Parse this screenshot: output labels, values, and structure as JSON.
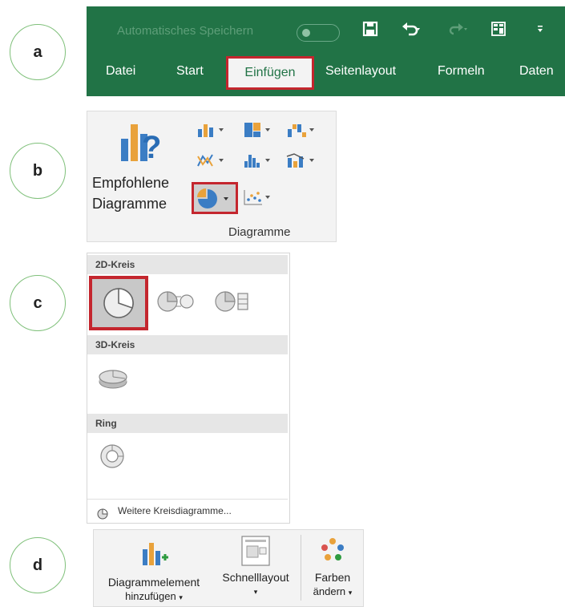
{
  "steps": [
    "a",
    "b",
    "c",
    "d"
  ],
  "ribbon": {
    "autosave_label": "Automatisches Speichern",
    "autosave_state": "off",
    "qat_icons": [
      "save-icon",
      "undo-icon",
      "redo-icon",
      "form-icon",
      "customize-icon"
    ],
    "tabs": [
      "Datei",
      "Start",
      "Einfügen",
      "Seitenlayout",
      "Formeln",
      "Daten"
    ],
    "active_tab": "Einfügen",
    "color_bg": "#217346",
    "highlight_color": "#c4262e"
  },
  "chart_group": {
    "recommended_line1": "Empfohlene",
    "recommended_line2": "Diagramme",
    "group_label": "Diagramme",
    "chart_icons": [
      "column-chart-icon",
      "hierarchy-chart-icon",
      "waterfall-chart-icon",
      "line-chart-icon",
      "statistic-chart-icon",
      "combo-chart-icon",
      "pie-chart-icon",
      "scatter-chart-icon"
    ],
    "selected_icon": "pie-chart-icon"
  },
  "pie_menu": {
    "sections": [
      "2D-Kreis",
      "3D-Kreis",
      "Ring"
    ],
    "items_2d": [
      "pie-icon",
      "pie-of-pie-icon",
      "bar-of-pie-icon"
    ],
    "items_3d": [
      "3d-pie-icon"
    ],
    "items_ring": [
      "doughnut-icon"
    ],
    "selected_item": "pie-icon",
    "more_label": "Weitere Kreisdiagramme..."
  },
  "chart_design": {
    "add_element_line1": "Diagrammelement",
    "add_element_line2": "hinzufügen",
    "quick_layout": "Schnelllayout",
    "colors_line1": "Farben",
    "colors_line2": "ändern"
  }
}
